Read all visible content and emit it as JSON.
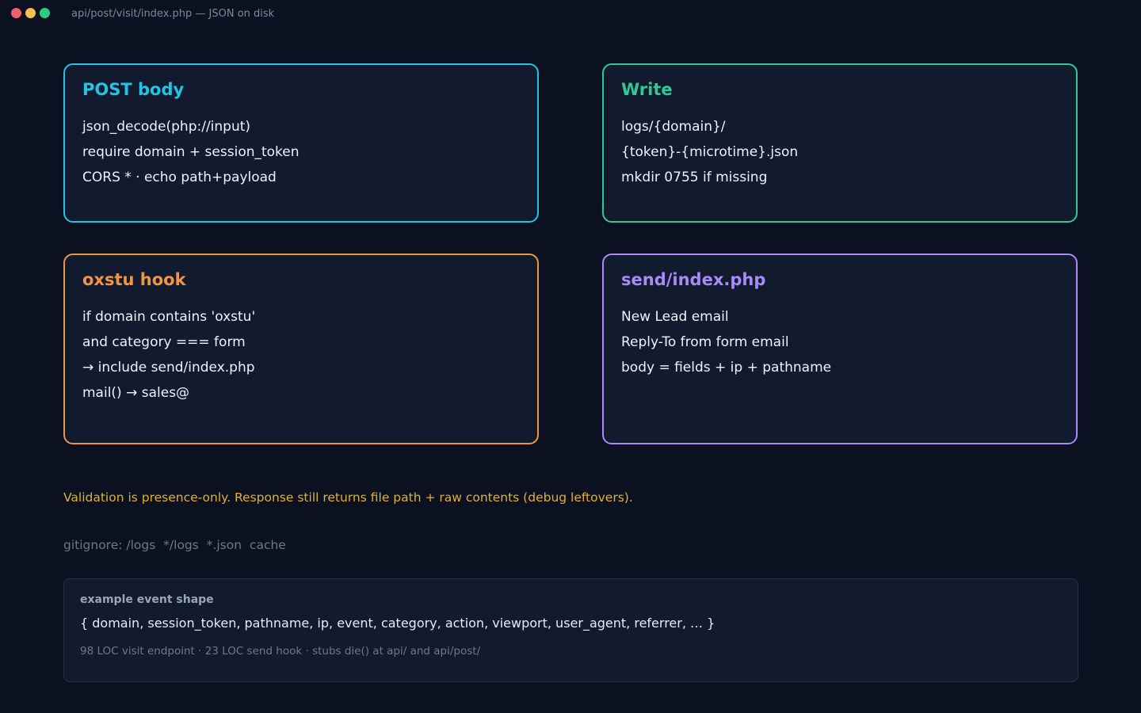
{
  "window": {
    "title": "api/post/visit/index.php — JSON on disk"
  },
  "colors": {
    "background": "#0b1120",
    "card_background": "#121b2e",
    "post_accent": "#22c5e4",
    "write_accent": "#2ec99a",
    "hook_accent": "#f59440",
    "send_accent": "#a78bfa",
    "warning": "#e2b22c"
  },
  "cards": {
    "post": {
      "title": "POST body",
      "lines": [
        "json_decode(php://input)",
        "require domain + session_token",
        "CORS * · echo path+payload"
      ]
    },
    "write": {
      "title": "Write",
      "lines": [
        "logs/{domain}/",
        "{token}-{microtime}.json",
        "mkdir 0755 if missing"
      ]
    },
    "hook": {
      "title": "oxstu hook",
      "lines": [
        "if domain contains 'oxstu'",
        "and category === form",
        "→ include send/index.php",
        "mail() → sales@"
      ]
    },
    "send": {
      "title": "send/index.php",
      "lines": [
        "New Lead email",
        "Reply-To from form email",
        "body = fields + ip + pathname"
      ]
    }
  },
  "note": "Validation is presence-only. Response still returns file path + raw contents (debug leftovers).",
  "gitignore": "gitignore: /logs  */logs  *.json  cache",
  "example": {
    "heading": "example event shape",
    "shape": "{ domain, session_token, pathname, ip, event, category, action, viewport, user_agent, referrer, … }",
    "footer": "98 LOC visit endpoint · 23 LOC send hook · stubs die() at api/ and api/post/"
  }
}
